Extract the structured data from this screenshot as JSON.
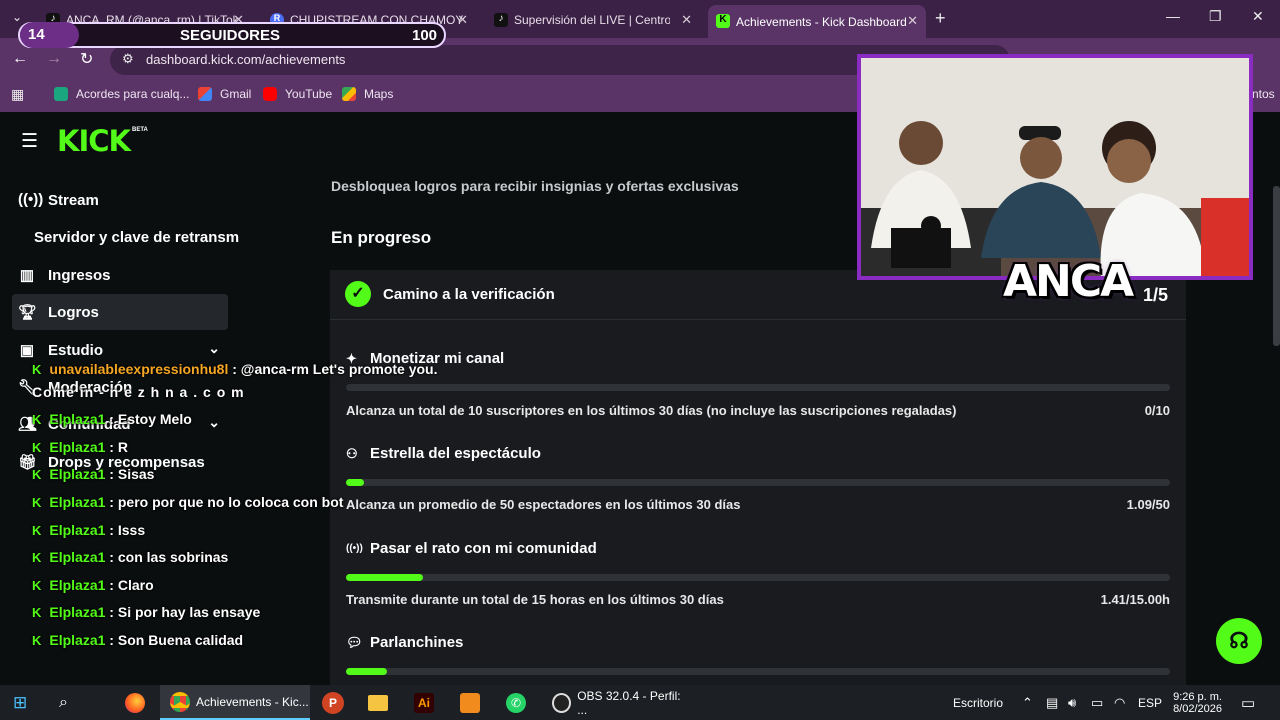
{
  "browser": {
    "tabs": [
      {
        "title": "ANCA_RM (@anca_rm) | TikTok",
        "active": false
      },
      {
        "title": "CHUPISTREAM CON CHAMOY",
        "active": false
      },
      {
        "title": "Supervisión del LIVE | Centro LIV",
        "active": false
      },
      {
        "title": "Achievements - Kick Dashboard",
        "active": true
      }
    ],
    "new_tab": "+",
    "url": "dashboard.kick.com/achievements",
    "bookmarks": [
      "Acordes para cualq...",
      "Gmail",
      "YouTube",
      "Maps"
    ],
    "bookmarks_more": "ntos"
  },
  "sidebar": {
    "logo": "KICK",
    "logo_badge": "BETA",
    "items": [
      {
        "label": "Stream",
        "icon": "broadcast-icon"
      },
      {
        "label": "Servidor y clave de retransm",
        "icon": ""
      },
      {
        "label": "Ingresos",
        "icon": "chart-icon"
      },
      {
        "label": "Logros",
        "icon": "trophy-icon"
      },
      {
        "label": "Estudio",
        "icon": "studio-icon"
      },
      {
        "label": "Moderación",
        "icon": "wrench-icon"
      },
      {
        "label": "Comunidad",
        "icon": "people-icon"
      },
      {
        "label": "Drops y recompensas",
        "icon": "gift-icon"
      }
    ]
  },
  "main": {
    "subtitle": "Desbloquea logros para recibir insignias y ofertas exclusivas",
    "section_title": "En progreso",
    "card": {
      "title": "Camino a la verificación",
      "count": "1/5",
      "achievements": [
        {
          "title": "Monetizar mi canal",
          "icon": "sparkle-icon",
          "desc": "Alcanza un total de 10 suscriptores en los últimos 30 días (no incluye las suscripciones regaladas)",
          "value": "0/10",
          "progress": 0.0
        },
        {
          "title": "Estrella del espectáculo",
          "icon": "audience-icon",
          "desc": "Alcanza un promedio de 50 espectadores en los últimos 30 días",
          "value": "1.09/50",
          "progress": 0.022
        },
        {
          "title": "Pasar el rato con mi comunidad",
          "icon": "broadcast-icon",
          "desc": "Transmite durante un total de 15 horas en los últimos 30 días",
          "value": "1.41/15.00h",
          "progress": 0.094
        },
        {
          "title": "Parlanchines",
          "icon": "chat-icon",
          "desc": "",
          "value": "",
          "progress": 0.05
        }
      ]
    }
  },
  "overlay": {
    "counter": {
      "current": "14",
      "label": "SEGUIDORES",
      "goal": "100",
      "progress": 0.14
    },
    "streamer_name": "ANCA",
    "watermark": "Come in  - n e z h n a . c o m",
    "chat": [
      {
        "user": "unavailableexpressionhu8l",
        "message": " : @anca-rm Let's promote you."
      },
      {
        "user": "Elplaza1",
        "message": " : Estoy Melo"
      },
      {
        "user": "Elplaza1",
        "message": " : R"
      },
      {
        "user": "Elplaza1",
        "message": " : Sisas"
      },
      {
        "user": "Elplaza1",
        "message": " : pero por que no lo coloca con bot"
      },
      {
        "user": "Elplaza1",
        "message": " : Isss"
      },
      {
        "user": "Elplaza1",
        "message": " : con las sobrinas"
      },
      {
        "user": "Elplaza1",
        "message": " : Claro"
      },
      {
        "user": "Elplaza1",
        "message": " : Si por hay las ensaye"
      },
      {
        "user": "Elplaza1",
        "message": " : Son Buena calidad"
      }
    ]
  },
  "taskbar": {
    "apps": [
      "Achievements - Kic...",
      "OBS 32.0.4 - Perfil: ..."
    ],
    "desktop_label": "Escritorio",
    "lang": "ESP",
    "time": "9:26 p. m.",
    "date": "8/02/2026"
  },
  "colors": {
    "kick_green": "#53fc18",
    "chrome_purple": "#5a3467",
    "page_bg": "#0b0e0f",
    "card_bg": "#191b1f"
  }
}
